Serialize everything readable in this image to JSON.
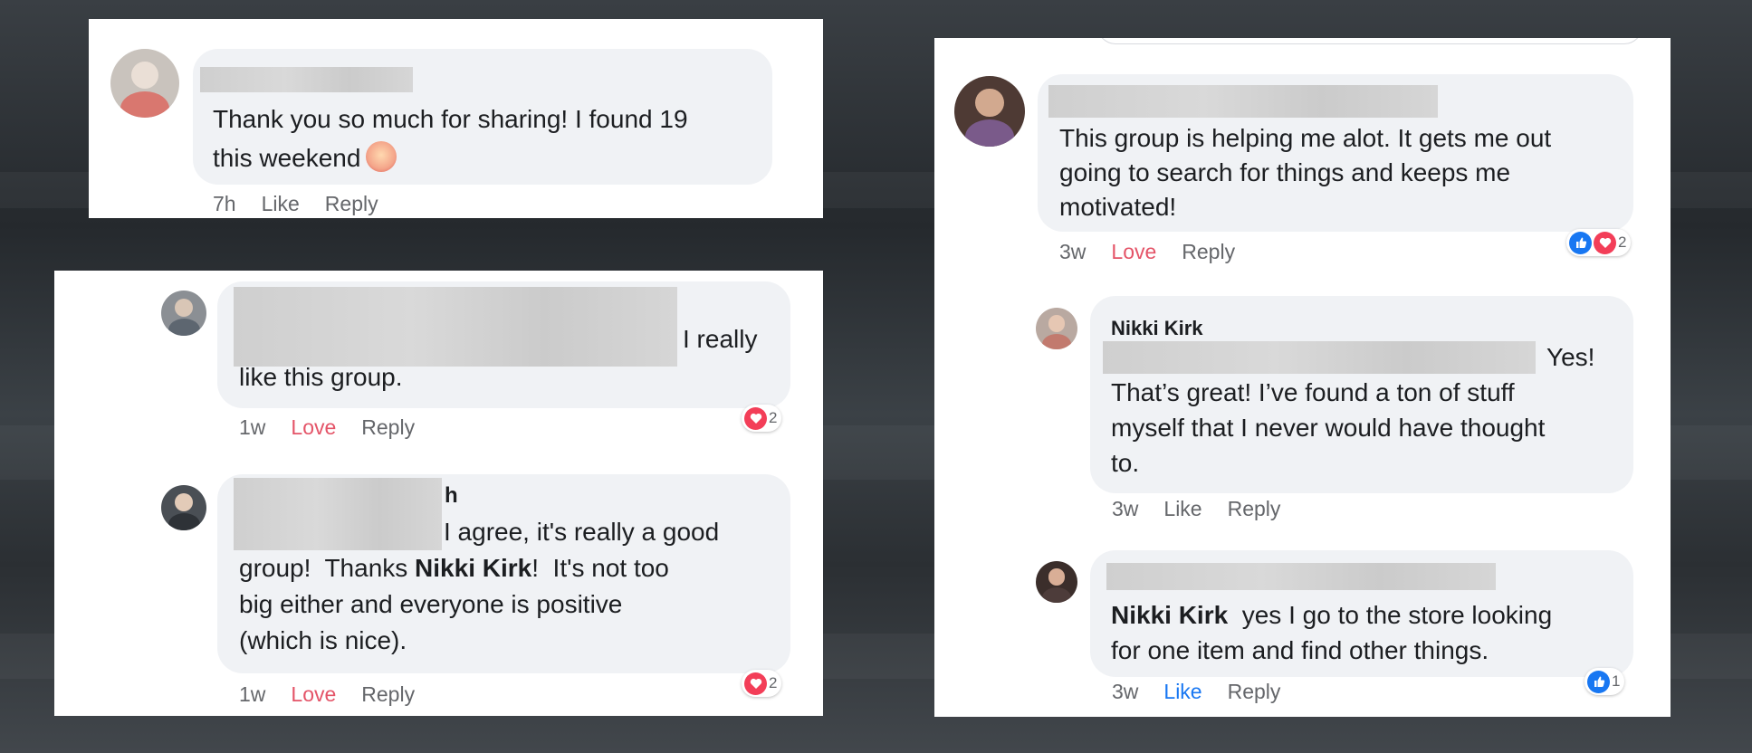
{
  "comments": [
    {
      "text_lines": [
        "Thank you so much for sharing! I found 19",
        "this weekend"
      ],
      "emoji": "screaming-face-emoji",
      "time": "7h",
      "like_label": "Like",
      "reply_label": "Reply"
    },
    {
      "text_lines": [
        "I really",
        "like this group."
      ],
      "time": "1w",
      "reaction_label": "Love",
      "reply_label": "Reply",
      "reaction_count": "2"
    },
    {
      "text_lines": [
        "h",
        "I agree, it's really a good",
        "group!  Thanks ",
        "Nikki Kirk",
        "!  It's not too",
        "big either and everyone is positive",
        "(which is nice)."
      ],
      "time": "1w",
      "reaction_label": "Love",
      "reply_label": "Reply",
      "reaction_count": "2"
    },
    {
      "text_lines": [
        "This group is helping me alot. It gets me out",
        "going to search for things and keeps me",
        "motivated!"
      ],
      "time": "3w",
      "reaction_label": "Love",
      "reply_label": "Reply",
      "reaction_count": "2"
    },
    {
      "author": "Nikki Kirk",
      "text_lines": [
        "Yes!",
        "That’s great! I’ve found a ton of stuff",
        "myself that I never would have thought",
        "to."
      ],
      "time": "3w",
      "like_label": "Like",
      "reply_label": "Reply"
    },
    {
      "mention": "Nikki Kirk",
      "text_lines": [
        "yes I go to the store looking",
        "for one item and find other things."
      ],
      "time": "3w",
      "like_label": "Like",
      "reply_label": "Reply",
      "reaction_count": "1"
    }
  ],
  "colors": {
    "love": "#e45468",
    "like": "#1877f2",
    "bubble": "#f0f2f5",
    "meta": "#65676b",
    "heart_icon": "#f33e58"
  }
}
